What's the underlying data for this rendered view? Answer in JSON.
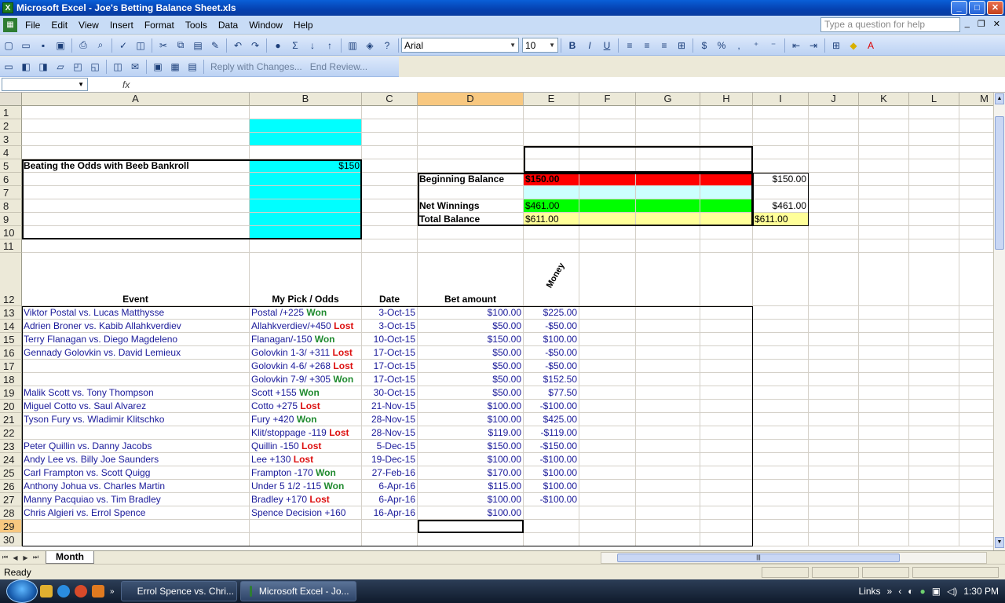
{
  "window": {
    "title": "Microsoft Excel - Joe's Betting Balance Sheet.xls",
    "app_icon": "excel-icon"
  },
  "menu": {
    "items": [
      "File",
      "Edit",
      "View",
      "Insert",
      "Format",
      "Tools",
      "Data",
      "Window",
      "Help"
    ],
    "help_placeholder": "Type a question for help"
  },
  "toolbar": {
    "font_name": "Arial",
    "font_size": "10",
    "bold": "B",
    "italic": "I",
    "underline": "U",
    "currency": "$",
    "percent": "%",
    "sum": "Σ"
  },
  "review_toolbar": {
    "reply": "Reply with Changes...",
    "end_review": "End Review..."
  },
  "formula_bar": {
    "name_box": "",
    "fx": "fx",
    "content": ""
  },
  "columns": [
    "A",
    "B",
    "C",
    "D",
    "E",
    "F",
    "G",
    "H",
    "I",
    "J",
    "K",
    "L",
    "M"
  ],
  "selected_column": "D",
  "selected_row": "29",
  "rows": [
    "1",
    "2",
    "3",
    "4",
    "5",
    "6",
    "7",
    "8",
    "9",
    "10",
    "11",
    "12",
    "13",
    "14",
    "15",
    "16",
    "17",
    "18",
    "19",
    "20",
    "21",
    "22",
    "23",
    "24",
    "25",
    "26",
    "27",
    "28",
    "29",
    "30"
  ],
  "summary": {
    "title": "Beating the Odds with Beeb Bankroll",
    "bankroll": "$150",
    "beginning_label": "Beginning Balance",
    "beginning_value": "$150.00",
    "beginning_i": "$150.00",
    "net_label": "Net Winnings",
    "net_value": "$461.00",
    "net_i": "$461.00",
    "total_label": "Total Balance",
    "total_value": "$611.00",
    "total_i": "$611.00"
  },
  "headers": {
    "event": "Event",
    "pick": "My Pick / Odds",
    "date": "Date",
    "bet": "Bet amount",
    "money": "Money"
  },
  "bets": [
    {
      "event": "Viktor Postal vs. Lucas Matthysse",
      "pick": "Postal /+225",
      "result": "Won",
      "date": "3-Oct-15",
      "bet": "$100.00",
      "money": "$225.00"
    },
    {
      "event": "Adrien Broner vs. Kabib Allahkverdiev",
      "pick": "Allahkverdiev/+450",
      "result": "Lost",
      "date": "3-Oct-15",
      "bet": "$50.00",
      "money": "-$50.00"
    },
    {
      "event": "Terry Flanagan vs. Diego Magdeleno",
      "pick": "Flanagan/-150",
      "result": "Won",
      "date": "10-Oct-15",
      "bet": "$150.00",
      "money": "$100.00"
    },
    {
      "event": "Gennady Golovkin vs. David Lemieux",
      "pick": "Golovkin 1-3/ +311",
      "result": "Lost",
      "date": "17-Oct-15",
      "bet": "$50.00",
      "money": "-$50.00"
    },
    {
      "event": "",
      "pick": "Golovkin 4-6/ +268",
      "result": "Lost",
      "date": "17-Oct-15",
      "bet": "$50.00",
      "money": "-$50.00"
    },
    {
      "event": "",
      "pick": "Golovkin 7-9/ +305",
      "result": "Won",
      "date": "17-Oct-15",
      "bet": "$50.00",
      "money": "$152.50"
    },
    {
      "event": "Malik Scott vs. Tony Thompson",
      "pick": "Scott +155",
      "result": "Won",
      "date": "30-Oct-15",
      "bet": "$50.00",
      "money": "$77.50"
    },
    {
      "event": "Miguel Cotto vs. Saul Alvarez",
      "pick": "Cotto +275",
      "result": "Lost",
      "date": "21-Nov-15",
      "bet": "$100.00",
      "money": "-$100.00"
    },
    {
      "event": "Tyson Fury vs. Wladimir Klitschko",
      "pick": "Fury +420",
      "result": "Won",
      "date": "28-Nov-15",
      "bet": "$100.00",
      "money": "$425.00"
    },
    {
      "event": "",
      "pick": "Klit/stoppage -119",
      "result": "Lost",
      "date": "28-Nov-15",
      "bet": "$119.00",
      "money": "-$119.00"
    },
    {
      "event": "Peter Quillin vs. Danny Jacobs",
      "pick": "Quillin -150",
      "result": "Lost",
      "date": "5-Dec-15",
      "bet": "$150.00",
      "money": "-$150.00"
    },
    {
      "event": "Andy Lee vs. Billy Joe Saunders",
      "pick": "Lee +130",
      "result": "Lost",
      "date": "19-Dec-15",
      "bet": "$100.00",
      "money": "-$100.00"
    },
    {
      "event": "Carl Frampton vs. Scott Quigg",
      "pick": "Frampton -170",
      "result": "Won",
      "date": "27-Feb-16",
      "bet": "$170.00",
      "money": "$100.00"
    },
    {
      "event": "Anthony Johua vs. Charles Martin",
      "pick": "Under 5 1/2 -115",
      "result": "Won",
      "date": "6-Apr-16",
      "bet": "$115.00",
      "money": "$100.00"
    },
    {
      "event": "Manny Pacquiao vs. Tim Bradley",
      "pick": "Bradley +170",
      "result": "Lost",
      "date": "6-Apr-16",
      "bet": "$100.00",
      "money": "-$100.00"
    },
    {
      "event": "Chris Algieri vs. Errol Spence",
      "pick": "Spence Decision +160",
      "result": "",
      "date": "16-Apr-16",
      "bet": "$100.00",
      "money": ""
    }
  ],
  "sheet_tabs": [
    "Month"
  ],
  "status": {
    "text": "Ready"
  },
  "taskbar": {
    "apps": [
      "Errol Spence vs. Chri...",
      "Microsoft Excel - Jo..."
    ],
    "links": "Links",
    "time": "1:30 PM"
  },
  "colors": {
    "cyan": "#00ffff",
    "red": "#ff0000",
    "green": "#00ff00",
    "light_cyan": "#ccffff",
    "light_yellow": "#ffff99",
    "won": "#1f8a2e",
    "lost": "#dd1010"
  }
}
